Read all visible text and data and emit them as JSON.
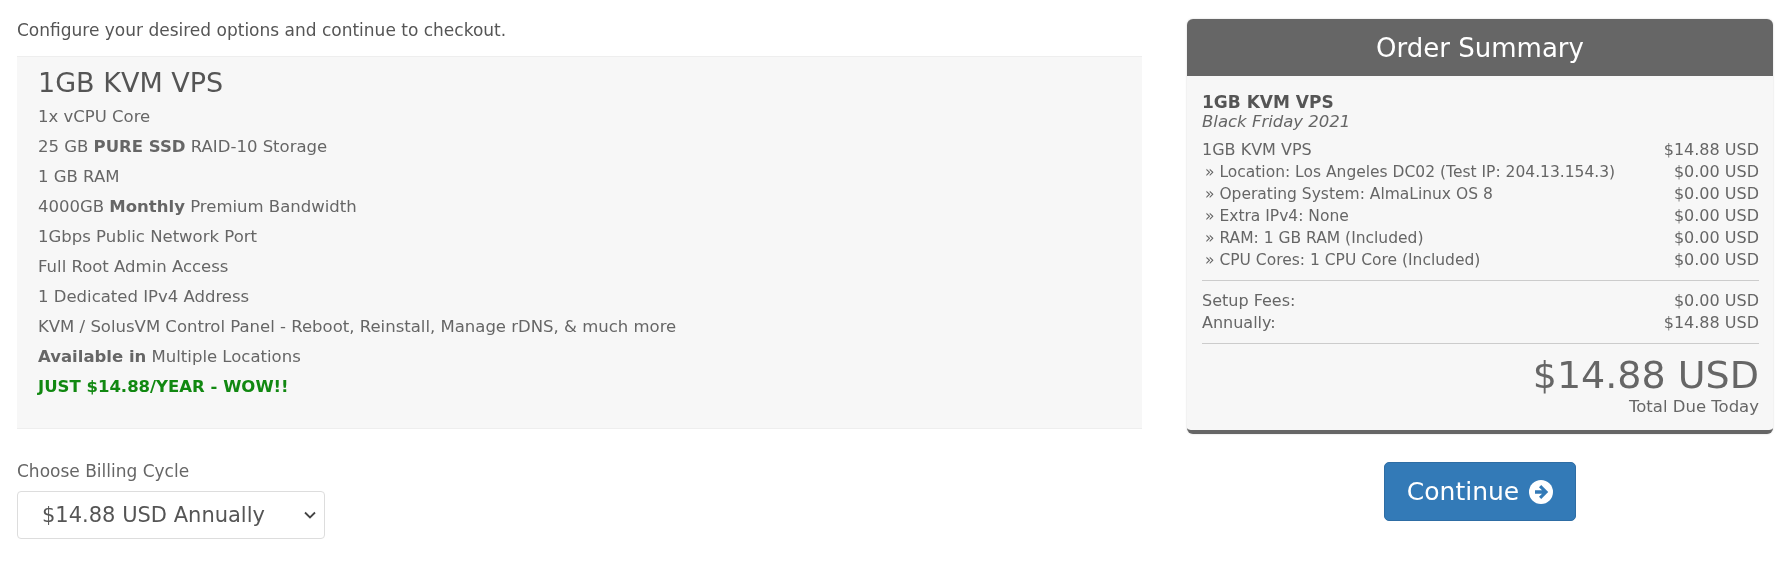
{
  "intro": "Configure your desired options and continue to checkout.",
  "product": {
    "title": "1GB KVM VPS",
    "features": [
      {
        "kind": "plain",
        "text": "1x vCPU Core"
      },
      {
        "kind": "plain",
        "text": "25 GB **PURE SSD** RAID-10 Storage"
      },
      {
        "kind": "plain",
        "text": "1 GB RAM"
      },
      {
        "kind": "plain",
        "text": "4000GB **Monthly** Premium Bandwidth"
      },
      {
        "kind": "plain",
        "text": "1Gbps Public Network Port"
      },
      {
        "kind": "plain",
        "text": "Full Root Admin Access"
      },
      {
        "kind": "plain",
        "text": "1 Dedicated IPv4 Address"
      },
      {
        "kind": "plain",
        "text": "KVM / SolusVM Control Panel - Reboot, Reinstall, Manage rDNS, & much more"
      },
      {
        "kind": "plain",
        "text": "**Available in** Multiple Locations"
      },
      {
        "kind": "promo",
        "text": "JUST $14.88/YEAR - WOW!!"
      }
    ]
  },
  "billing": {
    "label": "Choose Billing Cycle",
    "value": "$14.88 USD Annually"
  },
  "summary": {
    "title": "Order Summary",
    "product": "1GB KVM VPS",
    "group": "Black Friday 2021",
    "lines": [
      {
        "kind": "item",
        "label": "1GB KVM VPS",
        "amount": "$14.88 USD"
      },
      {
        "kind": "option",
        "label": "» Location: Los Angeles DC02 (Test IP: 204.13.154.3)",
        "amount": "$0.00 USD"
      },
      {
        "kind": "option",
        "label": "» Operating System: AlmaLinux OS 8",
        "amount": "$0.00 USD"
      },
      {
        "kind": "option",
        "label": "» Extra IPv4: None",
        "amount": "$0.00 USD"
      },
      {
        "kind": "option",
        "label": "» RAM: 1 GB RAM (Included)",
        "amount": "$0.00 USD"
      },
      {
        "kind": "option",
        "label": "» CPU Cores: 1 CPU Core (Included)",
        "amount": "$0.00 USD"
      }
    ],
    "fees": [
      {
        "label": "Setup Fees:",
        "amount": "$0.00 USD"
      },
      {
        "label": "Annually:",
        "amount": "$14.88 USD"
      }
    ],
    "total": "$14.88 USD",
    "total_label": "Total Due Today"
  },
  "continue_button": "Continue"
}
